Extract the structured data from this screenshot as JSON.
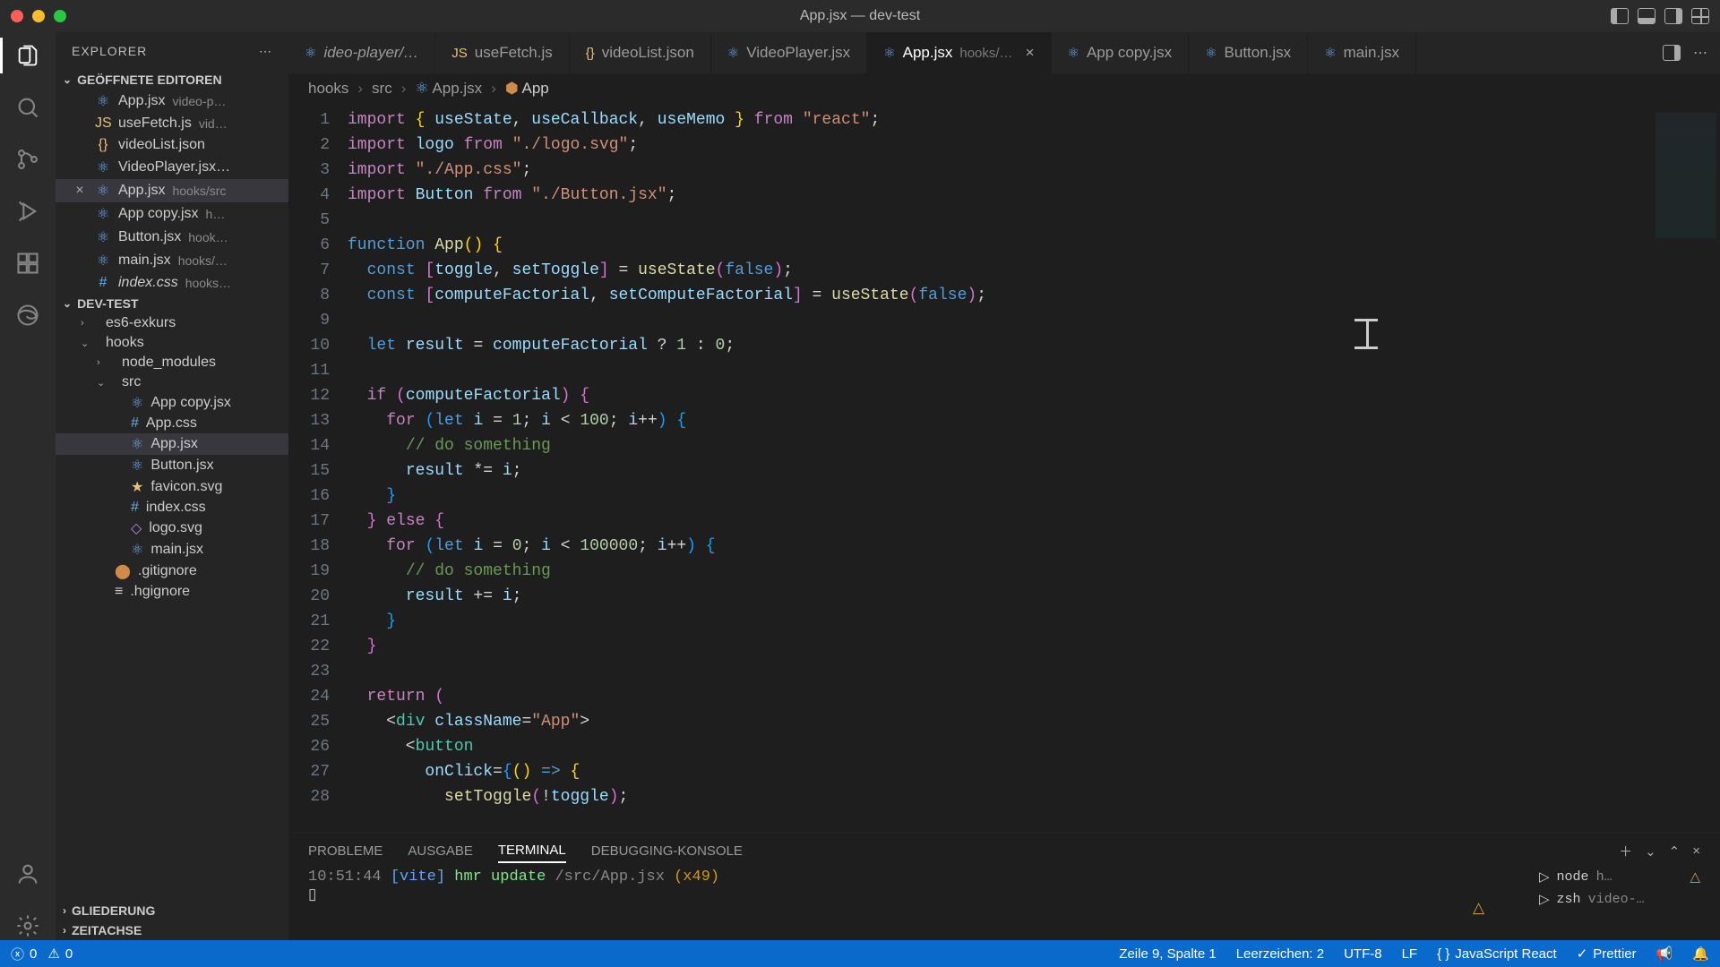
{
  "titlebar": {
    "title": "App.jsx — dev-test"
  },
  "activitybar": [
    {
      "name": "explorer-icon",
      "active": true
    },
    {
      "name": "search-icon",
      "active": false
    },
    {
      "name": "scm-icon",
      "active": false
    },
    {
      "name": "debug-icon",
      "active": false
    },
    {
      "name": "extensions-icon",
      "active": false
    },
    {
      "name": "edge-icon",
      "active": false
    }
  ],
  "sidebar": {
    "title": "EXPLORER",
    "openEditorsHeader": "GEÖFFNETE EDITOREN",
    "openEditors": [
      {
        "icon": "⚛",
        "iconClass": "ic-b",
        "name": "App.jsx",
        "dim": "video-p…"
      },
      {
        "icon": "JS",
        "iconClass": "ic-y",
        "name": "useFetch.js",
        "dim": "vid…"
      },
      {
        "icon": "{}",
        "iconClass": "ic-y",
        "name": "videoList.json",
        "dim": ""
      },
      {
        "icon": "⚛",
        "iconClass": "ic-b",
        "name": "VideoPlayer.jsx…",
        "dim": ""
      },
      {
        "icon": "⚛",
        "iconClass": "ic-b",
        "name": "App.jsx",
        "dim": "hooks/src",
        "active": true,
        "close": true
      },
      {
        "icon": "⚛",
        "iconClass": "ic-b",
        "name": "App copy.jsx",
        "dim": "h…"
      },
      {
        "icon": "⚛",
        "iconClass": "ic-b",
        "name": "Button.jsx",
        "dim": "hook…"
      },
      {
        "icon": "⚛",
        "iconClass": "ic-b",
        "name": "main.jsx",
        "dim": "hooks/…"
      },
      {
        "icon": "#",
        "iconClass": "ic-b",
        "name": "index.css",
        "dim": "hooks…",
        "italic": true
      }
    ],
    "projectHeader": "DEV-TEST",
    "tree": [
      {
        "indent": 1,
        "chev": "›",
        "icon": "",
        "label": "es6-exkurs"
      },
      {
        "indent": 1,
        "chev": "⌄",
        "icon": "",
        "label": "hooks"
      },
      {
        "indent": 2,
        "chev": "›",
        "icon": "",
        "label": "node_modules"
      },
      {
        "indent": 2,
        "chev": "⌄",
        "icon": "",
        "label": "src"
      },
      {
        "indent": 3,
        "chev": "",
        "icon": "⚛",
        "iconClass": "ic-b",
        "label": "App copy.jsx"
      },
      {
        "indent": 3,
        "chev": "",
        "icon": "#",
        "iconClass": "ic-b",
        "label": "App.css"
      },
      {
        "indent": 3,
        "chev": "",
        "icon": "⚛",
        "iconClass": "ic-b",
        "label": "App.jsx",
        "active": true
      },
      {
        "indent": 3,
        "chev": "",
        "icon": "⚛",
        "iconClass": "ic-b",
        "label": "Button.jsx"
      },
      {
        "indent": 3,
        "chev": "",
        "icon": "★",
        "iconClass": "ic-y",
        "label": "favicon.svg"
      },
      {
        "indent": 3,
        "chev": "",
        "icon": "#",
        "iconClass": "ic-b",
        "label": "index.css"
      },
      {
        "indent": 3,
        "chev": "",
        "icon": "◇",
        "iconClass": "ic-p",
        "label": "logo.svg"
      },
      {
        "indent": 3,
        "chev": "",
        "icon": "⚛",
        "iconClass": "ic-b",
        "label": "main.jsx"
      },
      {
        "indent": 2,
        "chev": "",
        "icon": "⬤",
        "iconClass": "ic-o",
        "label": ".gitignore"
      },
      {
        "indent": 2,
        "chev": "",
        "icon": "≡",
        "iconClass": "",
        "label": ".hgignore"
      }
    ],
    "outlineHeader": "GLIEDERUNG",
    "timelineHeader": "ZEITACHSE"
  },
  "tabs": [
    {
      "icon": "⚛",
      "iconClass": "ic-b",
      "label": "ideo-player/…",
      "italic": true
    },
    {
      "icon": "JS",
      "iconClass": "ic-y",
      "label": "useFetch.js"
    },
    {
      "icon": "{}",
      "iconClass": "ic-y",
      "label": "videoList.json"
    },
    {
      "icon": "⚛",
      "iconClass": "ic-b",
      "label": "VideoPlayer.jsx"
    },
    {
      "icon": "⚛",
      "iconClass": "ic-b",
      "label": "App.jsx",
      "desc": "hooks/…",
      "active": true,
      "close": true
    },
    {
      "icon": "⚛",
      "iconClass": "ic-b",
      "label": "App copy.jsx"
    },
    {
      "icon": "⚛",
      "iconClass": "ic-b",
      "label": "Button.jsx"
    },
    {
      "icon": "⚛",
      "iconClass": "ic-b",
      "label": "main.jsx"
    }
  ],
  "breadcrumb": [
    "hooks",
    "src",
    "App.jsx",
    "App"
  ],
  "code": [
    "<span class='tok-kw'>import</span> <span class='tok-br'>{</span> <span class='tok-id'>useState</span>, <span class='tok-id'>useCallback</span>, <span class='tok-id'>useMemo</span> <span class='tok-br'>}</span> <span class='tok-kw'>from</span> <span class='tok-str'>\"react\"</span>;",
    "<span class='tok-kw'>import</span> <span class='tok-id'>logo</span> <span class='tok-kw'>from</span> <span class='tok-str'>\"./logo.svg\"</span>;",
    "<span class='tok-kw'>import</span> <span class='tok-str'>\"./App.css\"</span>;",
    "<span class='tok-kw'>import</span> <span class='tok-id'>Button</span> <span class='tok-kw'>from</span> <span class='tok-str'>\"./Button.jsx\"</span>;",
    "",
    "<span class='tok-def'>function</span> <span class='tok-fn'>App</span><span class='tok-br'>()</span> <span class='tok-br'>{</span>",
    "  <span class='tok-def'>const</span> <span class='tok-br2'>[</span><span class='tok-id'>toggle</span>, <span class='tok-id'>setToggle</span><span class='tok-br2'>]</span> = <span class='tok-fn'>useState</span><span class='tok-br2'>(</span><span class='tok-bool'>false</span><span class='tok-br2'>)</span>;",
    "  <span class='tok-def'>const</span> <span class='tok-br2'>[</span><span class='tok-id'>computeFactorial</span>, <span class='tok-id'>setComputeFactorial</span><span class='tok-br2'>]</span> = <span class='tok-fn'>useState</span><span class='tok-br2'>(</span><span class='tok-bool'>false</span><span class='tok-br2'>)</span>;",
    "",
    "  <span class='tok-def'>let</span> <span class='tok-id'>result</span> = <span class='tok-id'>computeFactorial</span> ? <span class='tok-num'>1</span> : <span class='tok-num'>0</span>;",
    "",
    "  <span class='tok-kw'>if</span> <span class='tok-br2'>(</span><span class='tok-id'>computeFactorial</span><span class='tok-br2'>)</span> <span class='tok-br2'>{</span>",
    "    <span class='tok-kw'>for</span> <span class='tok-br3'>(</span><span class='tok-def'>let</span> <span class='tok-id'>i</span> = <span class='tok-num'>1</span>; <span class='tok-id'>i</span> &lt; <span class='tok-num'>100</span>; <span class='tok-id'>i</span>++<span class='tok-br3'>)</span> <span class='tok-br3'>{</span>",
    "      <span class='tok-cmt'>// do something</span>",
    "      <span class='tok-id'>result</span> *= <span class='tok-id'>i</span>;",
    "    <span class='tok-br3'>}</span>",
    "  <span class='tok-br2'>}</span> <span class='tok-kw'>else</span> <span class='tok-br2'>{</span>",
    "    <span class='tok-kw'>for</span> <span class='tok-br3'>(</span><span class='tok-def'>let</span> <span class='tok-id'>i</span> = <span class='tok-num'>0</span>; <span class='tok-id'>i</span> &lt; <span class='tok-num'>100000</span>; <span class='tok-id'>i</span>++<span class='tok-br3'>)</span> <span class='tok-br3'>{</span>",
    "      <span class='tok-cmt'>// do something</span>",
    "      <span class='tok-id'>result</span> += <span class='tok-id'>i</span>;",
    "    <span class='tok-br3'>}</span>",
    "  <span class='tok-br2'>}</span>",
    "",
    "  <span class='tok-kw'>return</span> <span class='tok-br2'>(</span>",
    "    &lt;<span class='tok-type'>div</span> <span class='tok-id'>className</span>=<span class='tok-str'>\"App\"</span>&gt;",
    "      &lt;<span class='tok-type'>button</span>",
    "        <span class='tok-id'>onClick</span>=<span class='tok-br3'>{</span><span class='tok-br'>(</span><span class='tok-br'>)</span> <span class='tok-def'>=&gt;</span> <span class='tok-br'>{</span>",
    "          <span class='tok-fn'>setToggle</span><span class='tok-br2'>(</span>!<span class='tok-id'>toggle</span><span class='tok-br2'>)</span>;"
  ],
  "lineStart": 1,
  "panel": {
    "tabs": [
      "PROBLEME",
      "AUSGABE",
      "TERMINAL",
      "DEBUGGING-KONSOLE"
    ],
    "activeTab": 2,
    "terminalLine": {
      "time": "10:51:44",
      "tag": "[vite]",
      "msg": "hmr update",
      "path": "/src/App.jsx",
      "count": "(x49)"
    },
    "sessions": [
      {
        "icon": "▷",
        "name": "node",
        "dim": "h…",
        "warn": true
      },
      {
        "icon": "▷",
        "name": "zsh",
        "dim": "video-…"
      }
    ]
  },
  "statusbar": {
    "errors": "0",
    "warnings": "0",
    "cursor": "Zeile 9, Spalte 1",
    "spaces": "Leerzeichen: 2",
    "encoding": "UTF-8",
    "eol": "LF",
    "lang": "JavaScript React",
    "prettier": "Prettier"
  }
}
